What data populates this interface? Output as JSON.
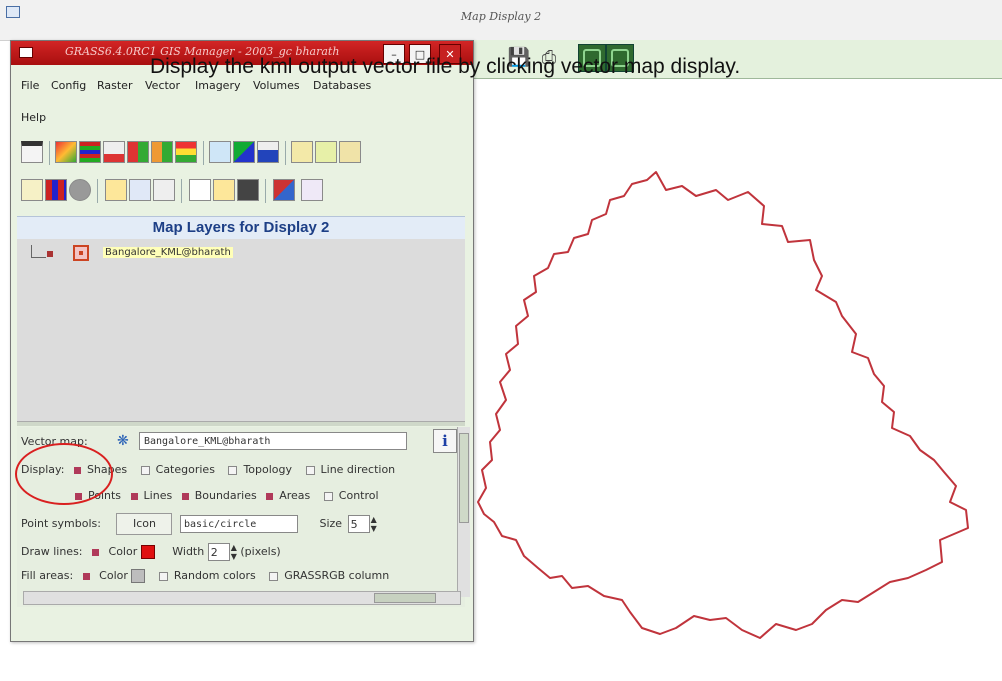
{
  "map_window": {
    "title": "Map Display 2",
    "toolbar": {
      "save_icon": "save-icon",
      "print_icon": "print-icon",
      "display_icons": [
        "display-map-icon",
        "redraw-map-icon"
      ]
    }
  },
  "caption": "Display the kml output vector file by clicking vector map display.",
  "gis_manager": {
    "title": "GRASS6.4.0RC1 GIS Manager - 2003_gc bharath",
    "menu": [
      "File",
      "Config",
      "Raster",
      "Vector",
      "Imagery",
      "Volumes",
      "Databases"
    ],
    "menu_row2": [
      "Help"
    ],
    "layers_header": "Map Layers for Display 2",
    "layer": {
      "name": "Bangalore_KML@bharath",
      "checked": true
    },
    "properties": {
      "vector_map_label": "Vector map:",
      "vector_map_value": "Bangalore_KML@bharath",
      "info_button": "i",
      "display_label": "Display:",
      "display_options_row1": [
        {
          "label": "Shapes",
          "checked": true
        },
        {
          "label": "Categories",
          "checked": false
        },
        {
          "label": "Topology",
          "checked": false
        },
        {
          "label": "Line direction",
          "checked": false
        }
      ],
      "display_options_row2": [
        {
          "label": "Points",
          "checked": true
        },
        {
          "label": "Lines",
          "checked": true
        },
        {
          "label": "Boundaries",
          "checked": true
        },
        {
          "label": "Areas",
          "checked": true
        },
        {
          "label": "Control",
          "checked": false
        }
      ],
      "point_symbols_label": "Point symbols:",
      "icon_button": "Icon",
      "symbol_value": "basic/circle",
      "size_label": "Size",
      "size_value": "5",
      "draw_lines_label": "Draw lines:",
      "color_label": "Color",
      "width_label": "Width",
      "width_value": "2",
      "pixels_label": "(pixels)",
      "fill_areas_label": "Fill areas:",
      "fill_color_label": "Color",
      "random_colors_label": "Random colors",
      "grassrgb_label": "GRASSRGB column"
    }
  },
  "colors": {
    "boundary": "#c0343c",
    "titlebar": "#c21a1a",
    "header_text": "#1d3f86",
    "highlight_circle": "#d92020"
  }
}
